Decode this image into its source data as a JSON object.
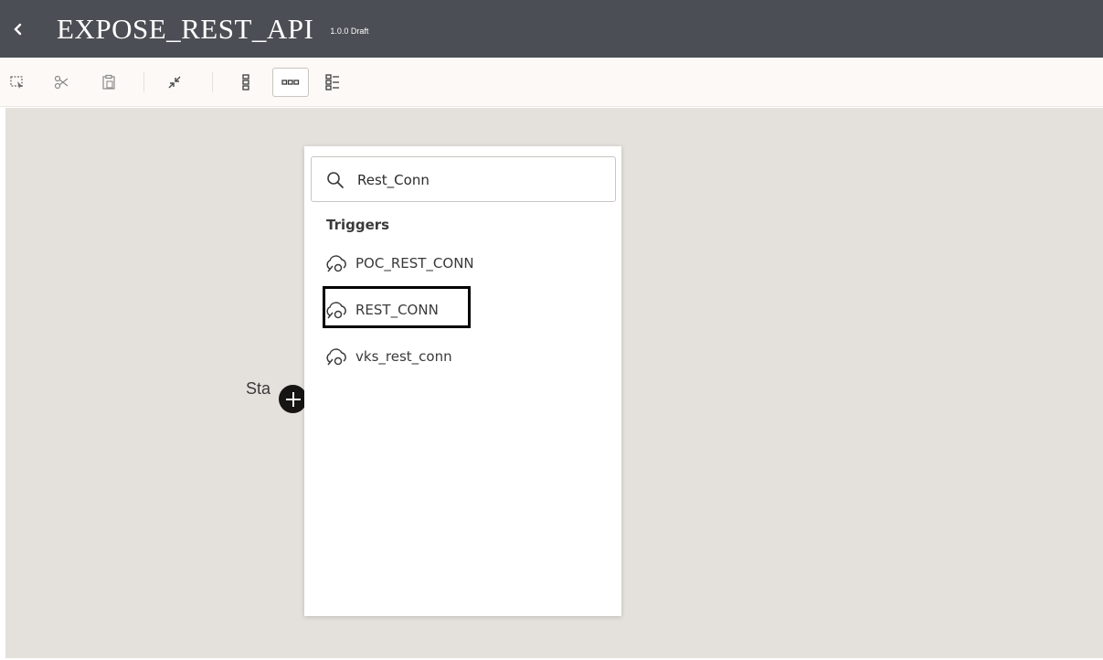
{
  "header": {
    "back_icon": "chevron-left-icon",
    "title": "EXPOSE_REST_API",
    "version": "1.0.0 Draft",
    "background": "#4b4e54"
  },
  "toolbar": {
    "buttons": [
      {
        "name": "select-icon"
      },
      {
        "name": "cut-icon"
      },
      {
        "name": "paste-icon"
      },
      {
        "name": "collapse-icon"
      },
      {
        "name": "vertical-layout-icon"
      },
      {
        "name": "horizontal-layout-icon",
        "active": true
      },
      {
        "name": "pseudo-view-icon"
      }
    ]
  },
  "canvas": {
    "start_label": "Sta",
    "add_icon": "plus-icon",
    "background": "#e4e1dc"
  },
  "popup": {
    "search": {
      "value": "Rest_Conn",
      "icon": "search-icon"
    },
    "section_heading": "Triggers",
    "items": [
      {
        "label": "POC_REST_CONN",
        "icon": "cloud-connection-icon"
      },
      {
        "label": "REST_CONN",
        "icon": "cloud-connection-icon",
        "highlighted": true
      },
      {
        "label": "vks_rest_conn",
        "icon": "cloud-connection-icon"
      }
    ]
  }
}
